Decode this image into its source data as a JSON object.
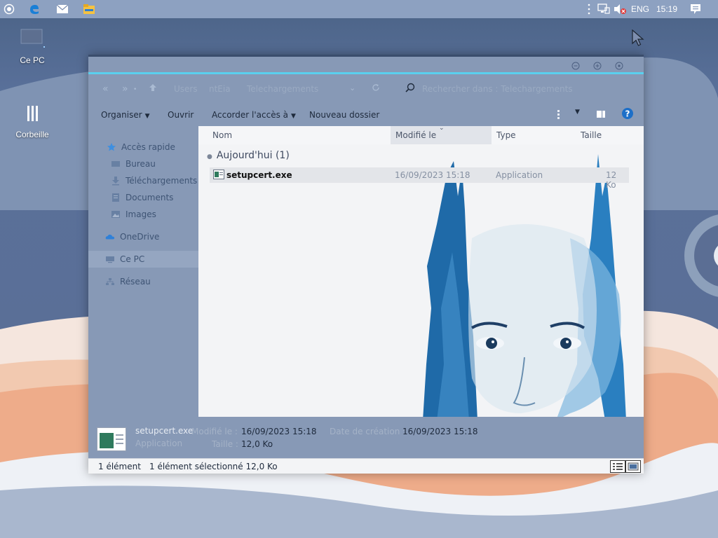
{
  "taskbar": {
    "icons": [
      "start-icon",
      "edge-icon",
      "mail-icon",
      "file-explorer-icon"
    ],
    "tray": {
      "language": "ENG",
      "time": "15:19"
    }
  },
  "desktop": {
    "icons": [
      {
        "label": "Ce PC",
        "icon": "computer-icon"
      },
      {
        "label": "Corbeille",
        "icon": "recycle-bin-icon"
      }
    ]
  },
  "window": {
    "address": {
      "crumbs": [
        "Users",
        "ntEia",
        "Telechargements"
      ],
      "search_placeholder": "Rechercher dans : Telechargements"
    },
    "commands": {
      "organize": "Organiser",
      "open": "Ouvrir",
      "share": "Accorder l'accès à",
      "new_folder": "Nouveau dossier"
    },
    "nav": {
      "quick_access": "Accès rapide",
      "desktop": "Bureau",
      "downloads": "Téléchargements",
      "documents": "Documents",
      "images": "Images",
      "onedrive": "OneDrive",
      "this_pc": "Ce PC",
      "network": "Réseau"
    },
    "columns": {
      "name": "Nom",
      "modified": "Modifié le",
      "type": "Type",
      "size": "Taille"
    },
    "group": "Aujourd'hui (1)",
    "files": [
      {
        "name": "setupcert.exe",
        "modified": "16/09/2023 15:18",
        "type": "Application",
        "size": "12 Ko"
      }
    ],
    "details": {
      "file_name": "setupcert.exe",
      "file_type": "Application",
      "modified_key": "Modifié le :",
      "modified_val": "16/09/2023 15:18",
      "size_key": "Taille :",
      "size_val": "12,0 Ko",
      "created_key": "Date de création :",
      "created_val": "16/09/2023 15:18"
    },
    "status": {
      "count": "1 élément",
      "selected": "1 élément sélectionné  12,0 Ko"
    }
  },
  "colors": {
    "accent": "#5ad0ee",
    "taskbar": "#8da1c1",
    "window": "#8799b6",
    "content_bg": "#f3f4f6"
  }
}
